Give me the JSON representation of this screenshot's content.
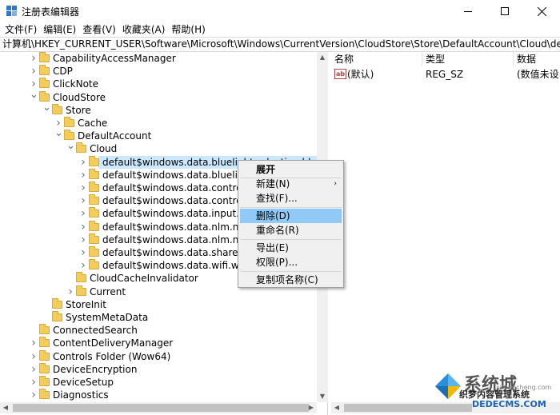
{
  "window": {
    "title": "注册表编辑器"
  },
  "menu": [
    "文件(F)",
    "编辑(E)",
    "查看(V)",
    "收藏夹(A)",
    "帮助(H)"
  ],
  "address": "计算机\\HKEY_CURRENT_USER\\Software\\Microsoft\\Windows\\CurrentVersion\\CloudStore\\Store\\DefaultAccount\\Cloud\\default$w",
  "tree": [
    {
      "label": "CapabilityAccessManager",
      "level": 0,
      "exp": "collapsed"
    },
    {
      "label": "CDP",
      "level": 0,
      "exp": "collapsed"
    },
    {
      "label": "ClickNote",
      "level": 0,
      "exp": "collapsed"
    },
    {
      "label": "CloudStore",
      "level": 0,
      "exp": "expanded"
    },
    {
      "label": "Store",
      "level": 1,
      "exp": "expanded"
    },
    {
      "label": "Cache",
      "level": 2,
      "exp": "collapsed"
    },
    {
      "label": "DefaultAccount",
      "level": 2,
      "exp": "expanded"
    },
    {
      "label": "Cloud",
      "level": 3,
      "exp": "expanded"
    },
    {
      "label": "default$windows.data.bluelightreduction.bluelight",
      "level": 4,
      "exp": "collapsed",
      "selected": true
    },
    {
      "label": "default$windows.data.bluelight",
      "level": 4,
      "exp": "collapsed"
    },
    {
      "label": "default$windows.data.controlce",
      "level": 4,
      "exp": "collapsed"
    },
    {
      "label": "default$windows.data.controlce",
      "level": 4,
      "exp": "collapsed"
    },
    {
      "label": "default$windows.data.input.his",
      "level": 4,
      "exp": "collapsed"
    },
    {
      "label": "default$windows.data.nlm.nlms",
      "level": 4,
      "exp": "collapsed"
    },
    {
      "label": "default$windows.data.nlm.nlms",
      "level": 4,
      "exp": "collapsed"
    },
    {
      "label": "default$windows.data.sharepicl",
      "level": 4,
      "exp": "collapsed"
    },
    {
      "label": "default$windows.data.wifi.wifip",
      "level": 4,
      "exp": "collapsed"
    },
    {
      "label": "CloudCacheInvalidator",
      "level": 3,
      "exp": "none"
    },
    {
      "label": "Current",
      "level": 3,
      "exp": "collapsed"
    },
    {
      "label": "StoreInit",
      "level": 1,
      "exp": "none"
    },
    {
      "label": "SystemMetaData",
      "level": 1,
      "exp": "none"
    },
    {
      "label": "ConnectedSearch",
      "level": 0,
      "exp": "none"
    },
    {
      "label": "ContentDeliveryManager",
      "level": 0,
      "exp": "collapsed"
    },
    {
      "label": "Controls Folder (Wow64)",
      "level": 0,
      "exp": "collapsed"
    },
    {
      "label": "DeviceEncryption",
      "level": 0,
      "exp": "collapsed"
    },
    {
      "label": "DeviceSetup",
      "level": 0,
      "exp": "collapsed"
    },
    {
      "label": "Diagnostics",
      "level": 0,
      "exp": "collapsed"
    }
  ],
  "columns": {
    "name": "名称",
    "type": "类型",
    "data": "数据"
  },
  "values": [
    {
      "icon": "ab",
      "name": "(默认)",
      "type": "REG_SZ",
      "data": "(数值未设"
    }
  ],
  "context_menu": [
    {
      "label": "展开",
      "bold": true
    },
    {
      "label": "新建(N)",
      "submenu": true
    },
    {
      "label": "查找(F)..."
    },
    {
      "label": "删除(D)",
      "highlighted": true
    },
    {
      "label": "重命名(R)"
    },
    {
      "label": "导出(E)"
    },
    {
      "label": "权限(P)..."
    },
    {
      "label": "复制项名称(C)"
    }
  ],
  "watermark": {
    "big": "系统城",
    "small": "xitongcheng.com",
    "line1": "织梦内容管理系统",
    "line2": "DEDECMS.COM"
  },
  "colors": {
    "selection": "#cce8ff",
    "menu_highlight": "#91c9f7",
    "folder": "#f3cc5a"
  }
}
